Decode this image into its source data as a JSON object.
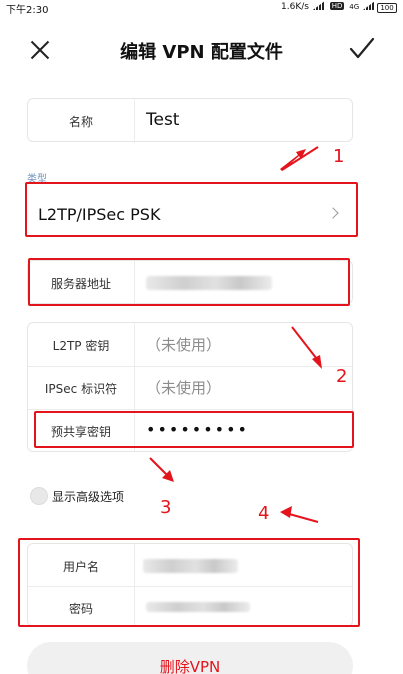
{
  "status_bar": {
    "time": "下午2:30",
    "net_speed": "1.6K/s",
    "net_type": "4G",
    "hd": "HD",
    "battery": "100"
  },
  "header": {
    "title": "编辑 VPN 配置文件",
    "close_icon": "close-icon",
    "confirm_icon": "check-icon"
  },
  "form": {
    "name_label": "名称",
    "name_value": "Test",
    "type_label": "类型",
    "type_value": "L2TP/IPSec PSK",
    "server_label": "服务器地址",
    "l2tp_secret_label": "L2TP 密钥",
    "l2tp_secret_value": "（未使用）",
    "ipsec_id_label": "IPSec 标识符",
    "ipsec_id_value": "（未使用）",
    "psk_label": "预共享密钥",
    "psk_value": "•••••••••",
    "advanced_label": "显示高级选项",
    "username_label": "用户名",
    "password_label": "密码"
  },
  "delete_label": "删除VPN",
  "annotations": [
    "1",
    "2",
    "3",
    "4"
  ],
  "colors": {
    "accent_red": "#e4141c",
    "type_label_blue": "#6e8fbe"
  }
}
